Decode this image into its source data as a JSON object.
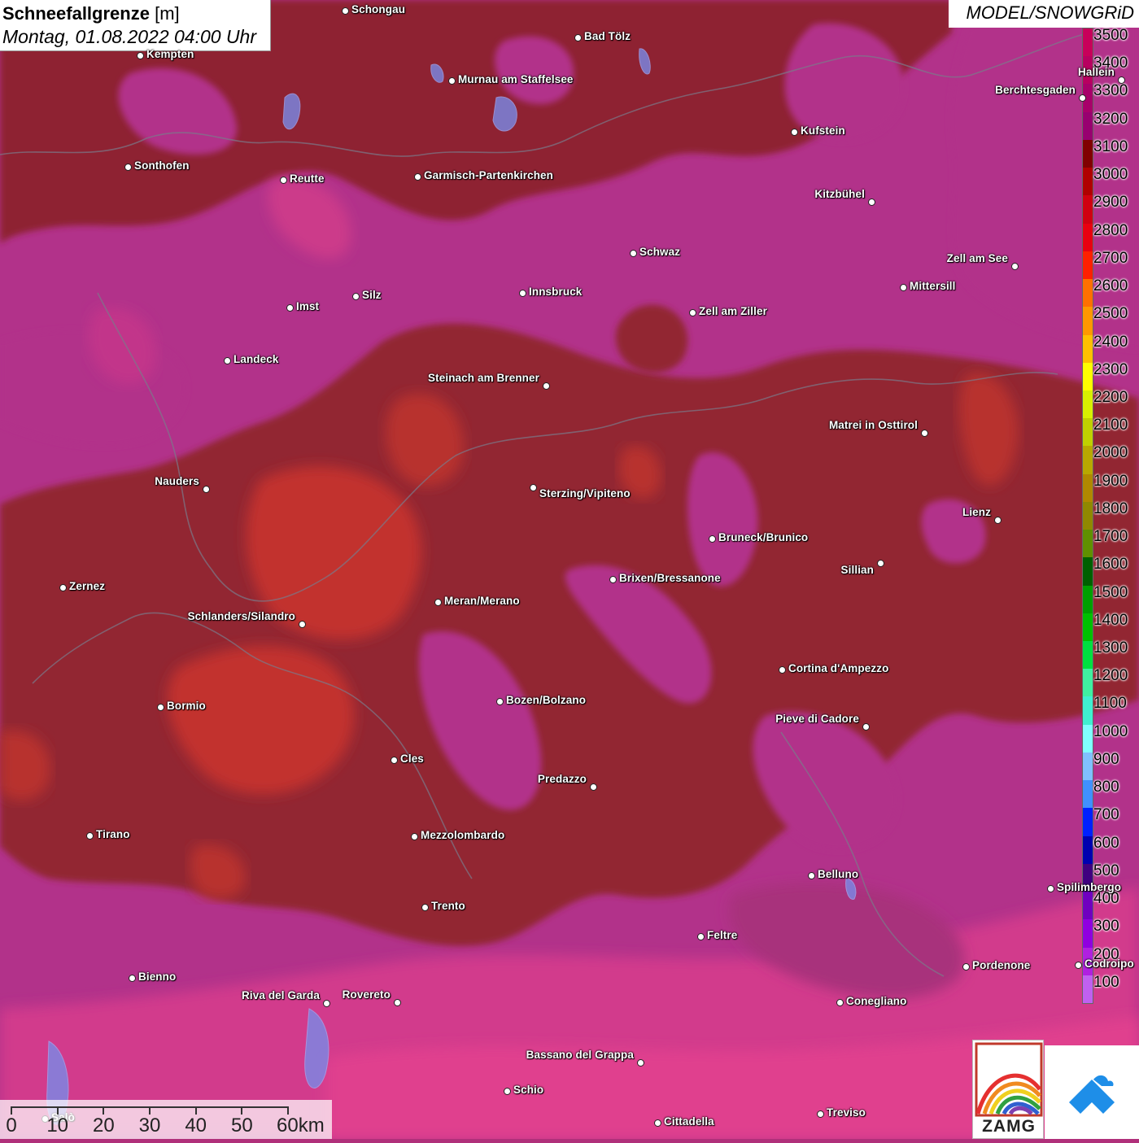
{
  "header": {
    "title": "Schneefallgrenze",
    "unit": "[m]",
    "datetime": "Montag, 01.08.2022 04:00 Uhr",
    "model": "MODEL/SNOWGRiD"
  },
  "legend": {
    "levels": [
      {
        "label": "3500",
        "color": "#c8005a"
      },
      {
        "label": "3400",
        "color": "#b80060"
      },
      {
        "label": "3300",
        "color": "#a8006a"
      },
      {
        "label": "3200",
        "color": "#980070"
      },
      {
        "label": "3100",
        "color": "#800000"
      },
      {
        "label": "3000",
        "color": "#b00000"
      },
      {
        "label": "2900",
        "color": "#d00010"
      },
      {
        "label": "2800",
        "color": "#e80010"
      },
      {
        "label": "2700",
        "color": "#ff2000"
      },
      {
        "label": "2600",
        "color": "#ff7000"
      },
      {
        "label": "2500",
        "color": "#ff9800"
      },
      {
        "label": "2400",
        "color": "#ffc000"
      },
      {
        "label": "2300",
        "color": "#ffff00"
      },
      {
        "label": "2200",
        "color": "#d8f000"
      },
      {
        "label": "2100",
        "color": "#c0d000"
      },
      {
        "label": "2000",
        "color": "#b8a800"
      },
      {
        "label": "1900",
        "color": "#b08800"
      },
      {
        "label": "1800",
        "color": "#908800"
      },
      {
        "label": "1700",
        "color": "#609000"
      },
      {
        "label": "1600",
        "color": "#006000"
      },
      {
        "label": "1500",
        "color": "#00a000"
      },
      {
        "label": "1400",
        "color": "#00c000"
      },
      {
        "label": "1300",
        "color": "#00e040"
      },
      {
        "label": "1200",
        "color": "#40f0a0"
      },
      {
        "label": "1100",
        "color": "#40f0d0"
      },
      {
        "label": "1000",
        "color": "#80ffff"
      },
      {
        "label": "900",
        "color": "#80c0ff"
      },
      {
        "label": "800",
        "color": "#4090ff"
      },
      {
        "label": "700",
        "color": "#0020ff"
      },
      {
        "label": "600",
        "color": "#0000b0"
      },
      {
        "label": "500",
        "color": "#400080"
      },
      {
        "label": "400",
        "color": "#7000c0"
      },
      {
        "label": "300",
        "color": "#9000e0"
      },
      {
        "label": "200",
        "color": "#b020e0"
      },
      {
        "label": "100",
        "color": "#c060f0"
      }
    ]
  },
  "cities": [
    {
      "name": "Schongau"
    },
    {
      "name": "Kempten"
    },
    {
      "name": "Bad Tölz"
    },
    {
      "name": "Murnau am Staffelsee"
    },
    {
      "name": "Hallein"
    },
    {
      "name": "Berchtesgaden"
    },
    {
      "name": "Kufstein"
    },
    {
      "name": "Sonthofen"
    },
    {
      "name": "Reutte"
    },
    {
      "name": "Garmisch-Partenkirchen"
    },
    {
      "name": "Kitzbühel"
    },
    {
      "name": "Schwaz"
    },
    {
      "name": "Zell am See"
    },
    {
      "name": "Mittersill"
    },
    {
      "name": "Imst"
    },
    {
      "name": "Silz"
    },
    {
      "name": "Innsbruck"
    },
    {
      "name": "Zell am Ziller"
    },
    {
      "name": "Landeck"
    },
    {
      "name": "Steinach am Brenner"
    },
    {
      "name": "Matrei in Osttirol"
    },
    {
      "name": "Nauders"
    },
    {
      "name": "Sterzing/Vipiteno"
    },
    {
      "name": "Lienz"
    },
    {
      "name": "Bruneck/Brunico"
    },
    {
      "name": "Sillian"
    },
    {
      "name": "Brixen/Bressanone"
    },
    {
      "name": "Zernez"
    },
    {
      "name": "Meran/Merano"
    },
    {
      "name": "Schlanders/Silandro"
    },
    {
      "name": "Cortina d'Ampezzo"
    },
    {
      "name": "Bozen/Bolzano"
    },
    {
      "name": "Bormio"
    },
    {
      "name": "Pieve di Cadore"
    },
    {
      "name": "Cles"
    },
    {
      "name": "Predazzo"
    },
    {
      "name": "Tirano"
    },
    {
      "name": "Mezzolombardo"
    },
    {
      "name": "Belluno"
    },
    {
      "name": "Spilimbergo"
    },
    {
      "name": "Trento"
    },
    {
      "name": "Feltre"
    },
    {
      "name": "Pordenone"
    },
    {
      "name": "Codroipo"
    },
    {
      "name": "Bienno"
    },
    {
      "name": "Riva del Garda"
    },
    {
      "name": "Rovereto"
    },
    {
      "name": "Conegliano"
    },
    {
      "name": "Bassano del Grappa"
    },
    {
      "name": "Schio"
    },
    {
      "name": "Treviso"
    },
    {
      "name": "Cittadella"
    },
    {
      "name": "Salò"
    }
  ],
  "scale": {
    "ticks": [
      "0",
      "10",
      "20",
      "30",
      "40",
      "50",
      "60km"
    ]
  },
  "logos": {
    "zamg": "ZAMG"
  }
}
